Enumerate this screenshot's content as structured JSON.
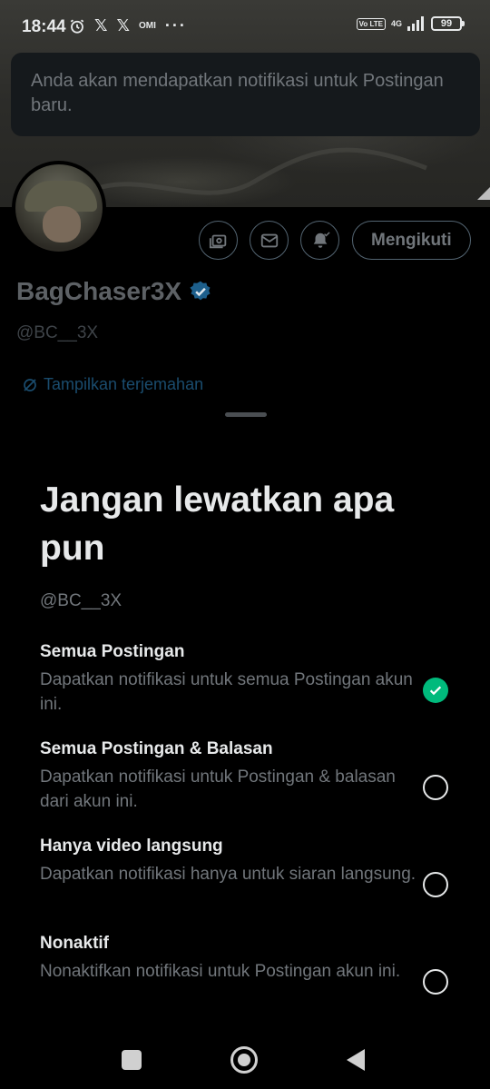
{
  "status_bar": {
    "time": "18:44",
    "left_icons": [
      "alarm-icon",
      "x-logo-icon",
      "x-logo-icon",
      "oml-icon",
      "more-dots-icon"
    ],
    "x_glyph": "𝕏",
    "oml": "OMI",
    "dots": "···",
    "volte": "Vo LTE",
    "network": "4G",
    "battery": "99"
  },
  "toast": {
    "text": "Anda akan mendapatkan notifikasi untuk Postingan baru."
  },
  "profile": {
    "display_name": "BagChaser3X",
    "handle": "@BC__3X",
    "translate_label": "Tampilkan terjemahan",
    "follow_label": "Mengikuti",
    "actions": [
      "subscriptions-icon",
      "message-icon",
      "notification-bell-icon"
    ],
    "verified_color": "#1d9bf0"
  },
  "sheet": {
    "title": "Jangan lewatkan apa pun",
    "handle": "@BC__3X",
    "options": [
      {
        "title": "Semua Postingan",
        "desc": "Dapatkan notifikasi untuk semua Postingan akun ini.",
        "selected": true
      },
      {
        "title": "Semua Postingan & Balasan",
        "desc": "Dapatkan notifikasi untuk Postingan & balasan dari akun ini.",
        "selected": false
      },
      {
        "title": "Hanya video langsung",
        "desc": "Dapatkan notifikasi hanya untuk siaran langsung.",
        "selected": false
      },
      {
        "title": "Nonaktif",
        "desc": "Nonaktifkan notifikasi untuk Postingan akun ini.",
        "selected": false
      }
    ],
    "accent_selected": "#00ba7c"
  },
  "nav": {
    "buttons": [
      "recents-square-icon",
      "home-circle-icon",
      "back-triangle-icon"
    ]
  }
}
